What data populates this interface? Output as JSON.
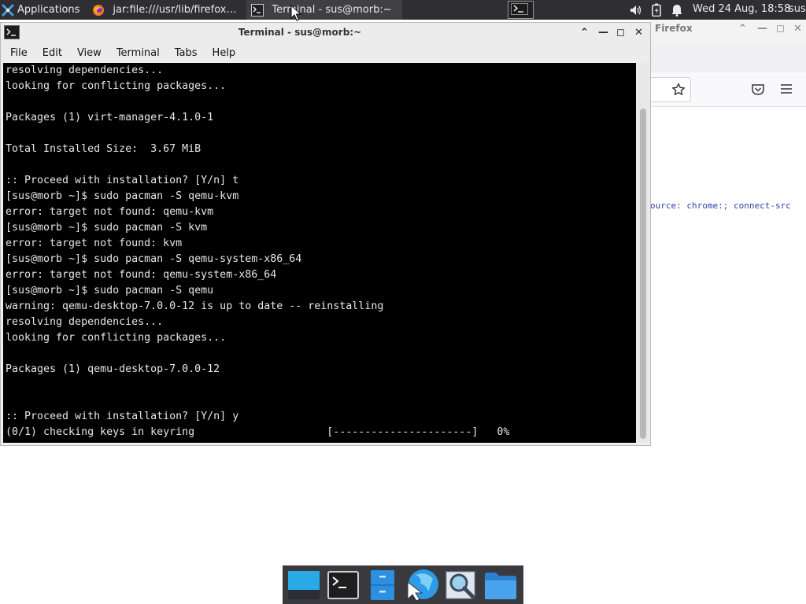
{
  "panel": {
    "applications_label": "Applications",
    "tasks": [
      {
        "label": "jar:file:///usr/lib/firefox/bro..."
      },
      {
        "label": "Terminal - sus@morb:~"
      }
    ],
    "clock": "Wed 24 Aug, 18:58",
    "user": "sus"
  },
  "firefox": {
    "title": "Firefox",
    "content_text": "ource: chrome:; connect-src"
  },
  "terminal": {
    "title": "Terminal - sus@morb:~",
    "menu": [
      "File",
      "Edit",
      "View",
      "Terminal",
      "Tabs",
      "Help"
    ],
    "lines": [
      "resolving dependencies...",
      "looking for conflicting packages...",
      "",
      "Packages (1) virt-manager-4.1.0-1",
      "",
      "Total Installed Size:  3.67 MiB",
      "",
      ":: Proceed with installation? [Y/n] t",
      "[sus@morb ~]$ sudo pacman -S qemu-kvm",
      "error: target not found: qemu-kvm",
      "[sus@morb ~]$ sudo pacman -S kvm",
      "error: target not found: kvm",
      "[sus@morb ~]$ sudo pacman -S qemu-system-x86_64",
      "error: target not found: qemu-system-x86_64",
      "[sus@morb ~]$ sudo pacman -S qemu",
      "warning: qemu-desktop-7.0.0-12 is up to date -- reinstalling",
      "resolving dependencies...",
      "looking for conflicting packages...",
      "",
      "Packages (1) qemu-desktop-7.0.0-12",
      "",
      "",
      ":: Proceed with installation? [Y/n] y",
      "(0/1) checking keys in keyring                     [----------------------]   0%"
    ]
  },
  "colors": {
    "panel_bg": "#2f2f33",
    "terminal_bg": "#000000",
    "terminal_fg": "#e6e6e6",
    "dock_bg": "#3a3a3e"
  },
  "dock": {
    "items": [
      {
        "icon": "desktop-icon"
      },
      {
        "icon": "terminal-icon"
      },
      {
        "icon": "file-manager-icon"
      },
      {
        "icon": "web-browser-icon"
      },
      {
        "icon": "search-icon"
      },
      {
        "icon": "folder-icon"
      }
    ]
  }
}
